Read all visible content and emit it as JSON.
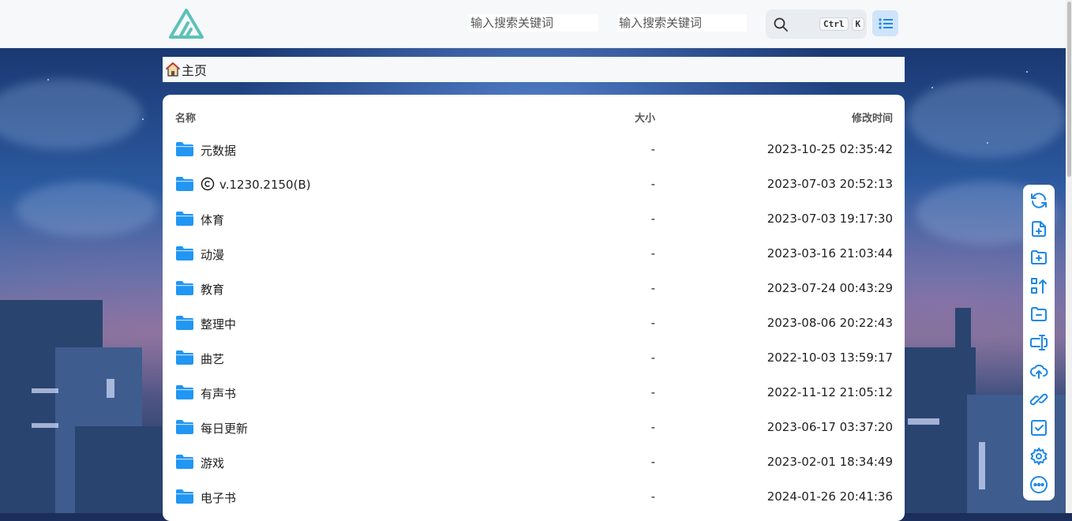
{
  "header": {
    "search_placeholder_1": "输入搜索关键词",
    "search_placeholder_2": "输入搜索关键词",
    "shortcut_ctrl": "Ctrl",
    "shortcut_k": "K"
  },
  "breadcrumb": {
    "home": "主页"
  },
  "table": {
    "headers": {
      "name": "名称",
      "size": "大小",
      "modified": "修改时间"
    },
    "rows": [
      {
        "name": "元数据",
        "size": "-",
        "modified": "2023-10-25 02:35:42"
      },
      {
        "name": "v.1230.2150(B)",
        "size": "-",
        "modified": "2023-07-03 20:52:13"
      },
      {
        "name": "体育",
        "size": "-",
        "modified": "2023-07-03 19:17:30"
      },
      {
        "name": "动漫",
        "size": "-",
        "modified": "2023-03-16 21:03:44"
      },
      {
        "name": "教育",
        "size": "-",
        "modified": "2023-07-24 00:43:29"
      },
      {
        "name": "整理中",
        "size": "-",
        "modified": "2023-08-06 20:22:43"
      },
      {
        "name": "曲艺",
        "size": "-",
        "modified": "2022-10-03 13:59:17"
      },
      {
        "name": "有声书",
        "size": "-",
        "modified": "2022-11-12 21:05:12"
      },
      {
        "name": "每日更新",
        "size": "-",
        "modified": "2023-06-17 03:37:20"
      },
      {
        "name": "游戏",
        "size": "-",
        "modified": "2023-02-01 18:34:49"
      },
      {
        "name": "电子书",
        "size": "-",
        "modified": "2024-01-26 20:41:36"
      }
    ]
  },
  "toolbar": {
    "icons": [
      "refresh-icon",
      "new-file-icon",
      "new-folder-icon",
      "upload-order-icon",
      "folder-minus-icon",
      "rename-icon",
      "upload-cloud-icon",
      "link-icon",
      "checkbox-icon",
      "settings-icon",
      "more-icon"
    ]
  },
  "colors": {
    "accent": "#1e88e5",
    "folder": "#2196f3",
    "logo": "#5cc2b8"
  }
}
